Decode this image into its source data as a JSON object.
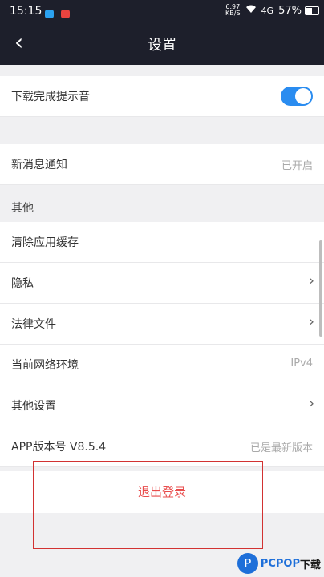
{
  "status_bar": {
    "time": "15:15",
    "net_speed": "6.97",
    "net_unit": "KB/S",
    "signal": "4G",
    "battery": "57%",
    "battery_level": 0.57
  },
  "nav": {
    "back_icon": "‹",
    "title": "设置"
  },
  "items": {
    "download_sound": {
      "label": "下载完成提示音",
      "enabled": true
    },
    "notifications": {
      "label": "新消息通知",
      "value": "已开启"
    },
    "section_other": "其他",
    "clear_cache": {
      "label": "清除应用缓存"
    },
    "privacy": {
      "label": "隐私",
      "chevron": "›"
    },
    "legal": {
      "label": "法律文件",
      "chevron": "›"
    },
    "network": {
      "label": "当前网络环境",
      "value": "IPv4"
    },
    "other_settings": {
      "label": "其他设置",
      "chevron": "›"
    },
    "version": {
      "label": "APP版本号 V8.5.4",
      "value": "已是最新版本"
    }
  },
  "logout": {
    "label": "退出登录"
  },
  "watermark": {
    "logo": "P",
    "text": "PCPOP",
    "suffix": "下载"
  },
  "colors": {
    "header": "#1d1f2b",
    "accent": "#2a8cf0",
    "logout": "#e84c4c",
    "highlight": "#d23232"
  }
}
